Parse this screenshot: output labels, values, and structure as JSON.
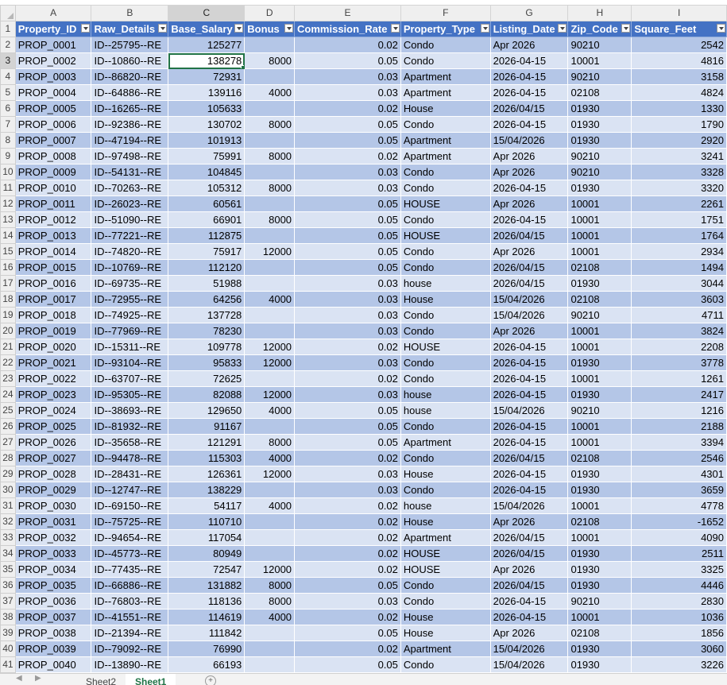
{
  "column_letters": [
    "A",
    "B",
    "C",
    "D",
    "E",
    "F",
    "G",
    "H",
    "I"
  ],
  "selected_column": "C",
  "selected_row": 3,
  "headers": [
    "Property_ID",
    "Raw_Details",
    "Base_Salary",
    "Bonus",
    "Commission_Rate",
    "Property_Type",
    "Listing_Date",
    "Zip_Code",
    "Square_Feet"
  ],
  "rows": [
    [
      "PROP_0001",
      "ID--25795--RE",
      "125277",
      "",
      "0.02",
      "Condo",
      "Apr 2026",
      "90210",
      "2542"
    ],
    [
      "PROP_0002",
      "ID--10860--RE",
      "138278",
      "8000",
      "0.05",
      "Condo",
      "2026-04-15",
      "10001",
      "4816"
    ],
    [
      "PROP_0003",
      "ID--86820--RE",
      "72931",
      "",
      "0.03",
      "Apartment",
      "2026-04-15",
      "90210",
      "3158"
    ],
    [
      "PROP_0004",
      "ID--64886--RE",
      "139116",
      "4000",
      "0.03",
      "Apartment",
      "2026-04-15",
      "02108",
      "4824"
    ],
    [
      "PROP_0005",
      "ID--16265--RE",
      "105633",
      "",
      "0.02",
      "House",
      "2026/04/15",
      "01930",
      "1330"
    ],
    [
      "PROP_0006",
      "ID--92386--RE",
      "130702",
      "8000",
      "0.05",
      "Condo",
      "2026-04-15",
      "01930",
      "1790"
    ],
    [
      "PROP_0007",
      "ID--47194--RE",
      "101913",
      "",
      "0.05",
      "Apartment",
      "15/04/2026",
      "01930",
      "2920"
    ],
    [
      "PROP_0008",
      "ID--97498--RE",
      "75991",
      "8000",
      "0.02",
      "Apartment",
      "Apr 2026",
      "90210",
      "3241"
    ],
    [
      "PROP_0009",
      "ID--54131--RE",
      "104845",
      "",
      "0.03",
      "Condo",
      "Apr 2026",
      "90210",
      "3328"
    ],
    [
      "PROP_0010",
      "ID--70263--RE",
      "105312",
      "8000",
      "0.03",
      " Condo",
      "2026-04-15",
      "01930",
      "3320"
    ],
    [
      "PROP_0011",
      "ID--26023--RE",
      "60561",
      "",
      "0.05",
      "HOUSE",
      "Apr 2026",
      "10001",
      "2261"
    ],
    [
      "PROP_0012",
      "ID--51090--RE",
      "66901",
      "8000",
      "0.05",
      "Condo",
      "2026-04-15",
      "10001",
      "1751"
    ],
    [
      "PROP_0013",
      "ID--77221--RE",
      "112875",
      "",
      "0.05",
      "HOUSE",
      "2026/04/15",
      "10001",
      "1764"
    ],
    [
      "PROP_0014",
      "ID--74820--RE",
      "75917",
      "12000",
      "0.05",
      " Condo",
      "Apr 2026",
      "10001",
      "2934"
    ],
    [
      "PROP_0015",
      "ID--10769--RE",
      "112120",
      "",
      "0.05",
      " Condo",
      "2026/04/15",
      "02108",
      "1494"
    ],
    [
      "PROP_0016",
      "ID--69735--RE",
      "51988",
      "",
      "0.03",
      "house",
      "2026/04/15",
      "01930",
      "3044"
    ],
    [
      "PROP_0017",
      "ID--72955--RE",
      "64256",
      "4000",
      "0.03",
      "House",
      "15/04/2026",
      "02108",
      "3603"
    ],
    [
      "PROP_0018",
      "ID--74925--RE",
      "137728",
      "",
      "0.03",
      " Condo",
      "15/04/2026",
      "90210",
      "4711"
    ],
    [
      "PROP_0019",
      "ID--77969--RE",
      "78230",
      "",
      "0.03",
      " Condo",
      "Apr 2026",
      "10001",
      "3824"
    ],
    [
      "PROP_0020",
      "ID--15311--RE",
      "109778",
      "12000",
      "0.02",
      "HOUSE",
      "2026-04-15",
      "10001",
      "2208"
    ],
    [
      "PROP_0021",
      "ID--93104--RE",
      "95833",
      "12000",
      "0.03",
      " Condo",
      "2026-04-15",
      "01930",
      "3778"
    ],
    [
      "PROP_0022",
      "ID--63707--RE",
      "72625",
      "",
      "0.02",
      "Condo",
      "2026-04-15",
      "10001",
      "1261"
    ],
    [
      "PROP_0023",
      "ID--95305--RE",
      "82088",
      "12000",
      "0.03",
      "house",
      "2026-04-15",
      "01930",
      "2417"
    ],
    [
      "PROP_0024",
      "ID--38693--RE",
      "129650",
      "4000",
      "0.05",
      "house",
      "15/04/2026",
      "90210",
      "1216"
    ],
    [
      "PROP_0025",
      "ID--81932--RE",
      "91167",
      "",
      "0.05",
      "Condo",
      "2026-04-15",
      "10001",
      "2188"
    ],
    [
      "PROP_0026",
      "ID--35658--RE",
      "121291",
      "8000",
      "0.05",
      "Apartment",
      "2026-04-15",
      "10001",
      "3394"
    ],
    [
      "PROP_0027",
      "ID--94478--RE",
      "115303",
      "4000",
      "0.02",
      " Condo",
      "2026/04/15",
      "02108",
      "2546"
    ],
    [
      "PROP_0028",
      "ID--28431--RE",
      "126361",
      "12000",
      "0.03",
      "House",
      "2026-04-15",
      "01930",
      "4301"
    ],
    [
      "PROP_0029",
      "ID--12747--RE",
      "138229",
      "",
      "0.03",
      " Condo",
      "2026-04-15",
      "01930",
      "3659"
    ],
    [
      "PROP_0030",
      "ID--69150--RE",
      "54117",
      "4000",
      "0.02",
      "house",
      "15/04/2026",
      "10001",
      "4778"
    ],
    [
      "PROP_0031",
      "ID--75725--RE",
      "110710",
      "",
      "0.02",
      "House",
      "Apr 2026",
      "02108",
      "-1652"
    ],
    [
      "PROP_0032",
      "ID--94654--RE",
      "117054",
      "",
      "0.02",
      "Apartment",
      "2026/04/15",
      "10001",
      "4090"
    ],
    [
      "PROP_0033",
      "ID--45773--RE",
      "80949",
      "",
      "0.02",
      "HOUSE",
      "2026/04/15",
      "01930",
      "2511"
    ],
    [
      "PROP_0034",
      "ID--77435--RE",
      "72547",
      "12000",
      "0.02",
      "HOUSE",
      "Apr 2026",
      "01930",
      "3325"
    ],
    [
      "PROP_0035",
      "ID--66886--RE",
      "131882",
      "8000",
      "0.05",
      " Condo",
      "2026/04/15",
      "01930",
      "4446"
    ],
    [
      "PROP_0036",
      "ID--76803--RE",
      "118136",
      "8000",
      "0.03",
      " Condo",
      "2026-04-15",
      "90210",
      "2830"
    ],
    [
      "PROP_0037",
      "ID--41551--RE",
      "114619",
      "4000",
      "0.02",
      "House",
      "2026-04-15",
      "10001",
      "1036"
    ],
    [
      "PROP_0038",
      "ID--21394--RE",
      "111842",
      "",
      "0.05",
      "House",
      "Apr 2026",
      "02108",
      "1856"
    ],
    [
      "PROP_0039",
      "ID--79092--RE",
      "76990",
      "",
      "0.02",
      "Apartment",
      "15/04/2026",
      "01930",
      "3060"
    ],
    [
      "PROP_0040",
      "ID--13890--RE",
      "66193",
      "",
      "0.05",
      " Condo",
      "15/04/2026",
      "01930",
      "3226"
    ]
  ],
  "sheet_tabs": [
    "Sheet2",
    "Sheet1"
  ],
  "active_sheet": "Sheet1",
  "add_sheet_icon": "plus-circle-icon",
  "colors": {
    "header_fill": "#4472c4",
    "band_dark": "#b4c6e7",
    "band_light": "#dae3f3",
    "selection": "#217346"
  }
}
